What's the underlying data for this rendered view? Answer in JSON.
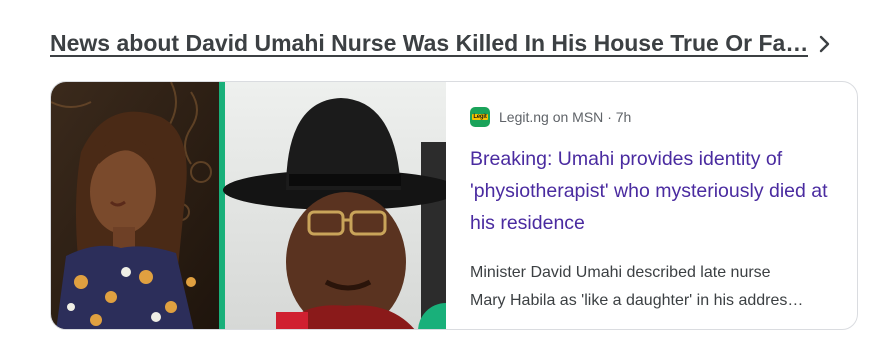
{
  "section": {
    "title": "News about David Umahi Nurse Was Killed In His House True Or Fa…",
    "more_icon": "chevron-right-icon"
  },
  "article": {
    "source_logo_text": "Legit",
    "source": "Legit.ng on MSN",
    "separator": "·",
    "age": "7h",
    "headline": "Breaking: Umahi provides identity of 'physiotherapist' who mysteriously died at his residence",
    "snippet": {
      "line1": "Minister David Umahi described late nurse",
      "line2": "Mary Habila as 'like a daughter' in his addres…"
    }
  },
  "colors": {
    "headline": "#4a2ba0",
    "title": "#3c4043",
    "meta": "#5f6368",
    "card_border": "#dadce0",
    "logo_green": "#1aa35a",
    "divider_green": "#19b07a"
  }
}
